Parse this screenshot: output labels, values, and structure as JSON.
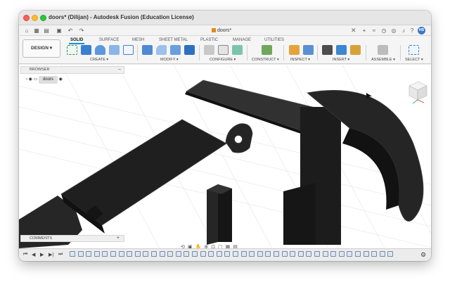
{
  "window": {
    "title": "doors* (Dilijan) - Autodesk Fusion (Education License)"
  },
  "quickbar": {
    "doc_tab": "doors*",
    "avatar": "HB"
  },
  "workspace": {
    "label": "DESIGN"
  },
  "tabs": [
    "SOLID",
    "SURFACE",
    "MESH",
    "SHEET METAL",
    "PLASTIC",
    "MANAGE",
    "UTILITIES"
  ],
  "active_tab": "SOLID",
  "groups": [
    "CREATE",
    "MODIFY",
    "CONFIGURE",
    "CONSTRUCT",
    "INSPECT",
    "INSERT",
    "ASSEMBLE",
    "SELECT"
  ],
  "browser": {
    "title": "BROWSER",
    "items": [
      {
        "label": "doors"
      }
    ]
  },
  "comments": {
    "title": "COMMENTS"
  },
  "colors": {
    "accent": "#0696d7",
    "model": "#2a2a2a",
    "doc_cube": "#e8861c"
  },
  "icons": [
    "home-icon",
    "grid-icon",
    "file-icon",
    "save-icon",
    "undo-icon",
    "redo-icon",
    "close-icon",
    "add-tab-icon",
    "notification-icon",
    "help-icon",
    "settings-icon",
    "eye-icon",
    "gear-icon",
    "play-icon",
    "orbit-icon",
    "pan-icon",
    "zoom-icon",
    "display-icon"
  ]
}
